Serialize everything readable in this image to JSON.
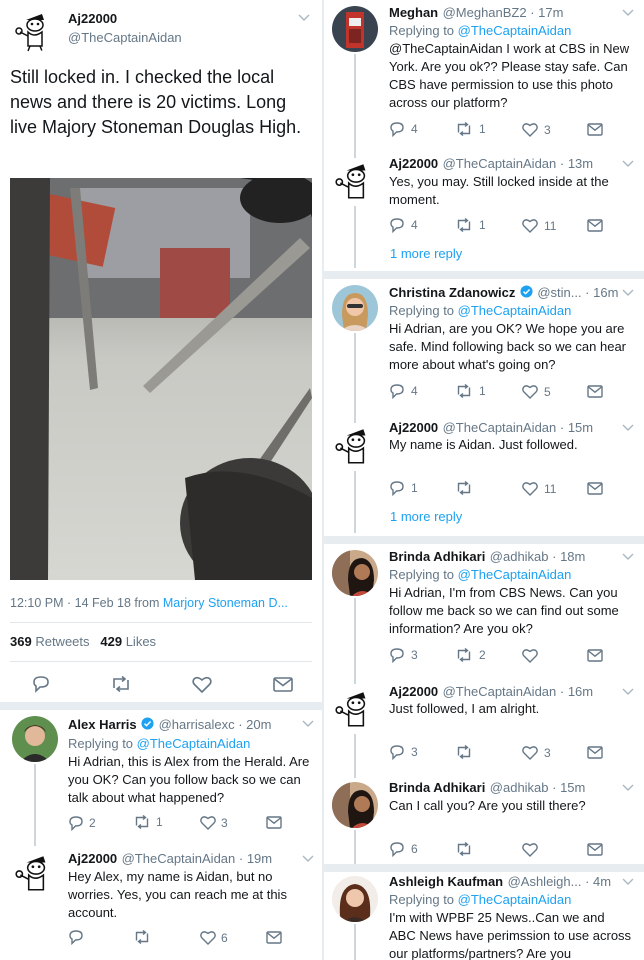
{
  "main_tweet": {
    "name": "Aj22000",
    "handle": "@TheCaptainAidan",
    "text": "Still locked in. I checked the local news and there is 20 victims. Long live Majory Stoneman Douglas High.",
    "time": "12:10 PM · 14 Feb 18 from ",
    "place": "Marjory Stoneman D...",
    "retweets_count": "369",
    "retweets_label": "Retweets",
    "likes_count": "429",
    "likes_label": "Likes"
  },
  "replying_prefix": "Replying to ",
  "replies_left": [
    {
      "name": "Alex Harris",
      "handle": "@harrisalexc · 20m",
      "replying": "@TheCaptainAidan",
      "text": "Hi Adrian, this is Alex from the Herald. Are you OK? Can you follow back so we can talk about what happened?",
      "reply_count": "2",
      "retweet_count": "1",
      "like_count": "3"
    },
    {
      "name": "Aj22000",
      "handle": "@TheCaptainAidan · 19m",
      "text": "Hey Alex, my name is Aidan, but no worries. Yes, you can reach me at this account.",
      "reply_count": "",
      "retweet_count": "",
      "like_count": "6"
    }
  ],
  "replies_right": [
    {
      "name": "Meghan",
      "handle": "@MeghanBZ2 · 17m",
      "replying": "@TheCaptainAidan",
      "text": "@TheCaptainAidan I work at CBS in New York. Are you ok?? Please stay safe. Can CBS have permission to use this photo across our platform?",
      "reply_count": "4",
      "retweet_count": "1",
      "like_count": "3"
    },
    {
      "name": "Aj22000",
      "handle": "@TheCaptainAidan · 13m",
      "text": "Yes, you may. Still locked inside at the moment.",
      "reply_count": "4",
      "retweet_count": "1",
      "like_count": "11",
      "more": "1 more reply"
    },
    {
      "name": "Christina Zdanowicz",
      "handle": "@stin... · 16m",
      "replying": "@TheCaptainAidan",
      "text": "Hi Adrian, are you OK? We hope you are safe. Mind following back so we can hear more about what's going on?",
      "reply_count": "4",
      "retweet_count": "1",
      "like_count": "5"
    },
    {
      "name": "Aj22000",
      "handle": "@TheCaptainAidan · 15m",
      "text": "My name is Aidan. Just followed.",
      "reply_count": "1",
      "retweet_count": "",
      "like_count": "11",
      "more": "1 more reply"
    },
    {
      "name": "Brinda Adhikari",
      "handle": "@adhikab · 18m",
      "replying": "@TheCaptainAidan",
      "text": "Hi Adrian, I'm from CBS News. Can you follow me back so we can find out some information? Are you ok?",
      "reply_count": "3",
      "retweet_count": "2",
      "like_count": ""
    },
    {
      "name": "Aj22000",
      "handle": "@TheCaptainAidan · 16m",
      "text": "Just followed, I am alright.",
      "reply_count": "3",
      "retweet_count": "",
      "like_count": "3"
    },
    {
      "name": "Brinda Adhikari",
      "handle": "@adhikab · 15m",
      "text": "Can I call you? Are you still there?",
      "reply_count": "6",
      "retweet_count": "",
      "like_count": ""
    },
    {
      "name": "Ashleigh Kaufman",
      "handle": "@Ashleigh... · 4m",
      "replying": "@TheCaptainAidan",
      "text": "I'm with WPBF 25 News..Can we and ABC News have perimssion to use across our platforms/partners? Are you"
    }
  ],
  "icons": {
    "reply": "reply-icon",
    "retweet": "retweet-icon",
    "like": "heart-icon",
    "message": "message-icon",
    "verified": "verified-badge-icon",
    "chevron": "chevron-down-icon"
  },
  "colors": {
    "link": "#1da1f2",
    "muted": "#657786",
    "text": "#14171a",
    "verified": "#1da1f2",
    "divider": "#e6ecf0"
  }
}
